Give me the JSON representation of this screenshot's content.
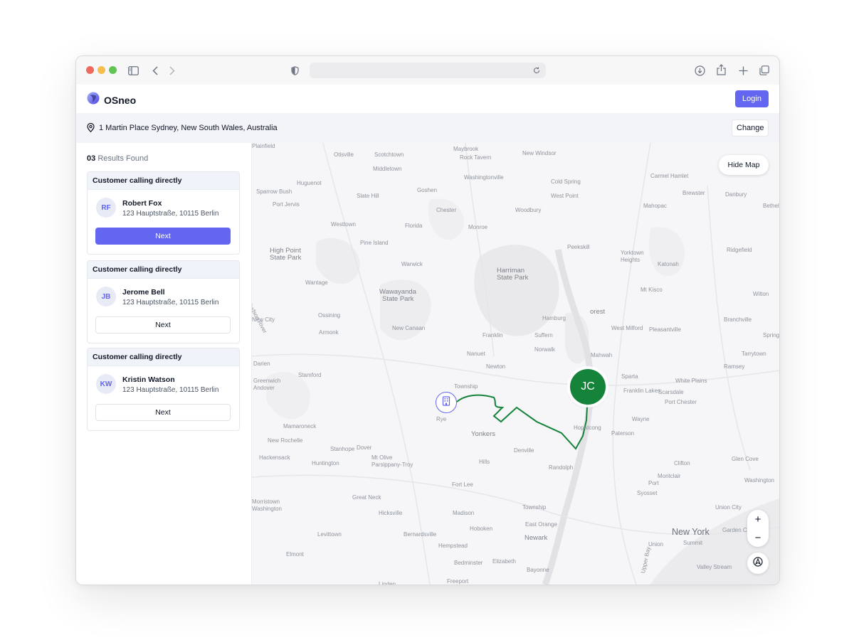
{
  "app": {
    "brand_name": "OSneo",
    "login_label": "Login"
  },
  "location": {
    "address": "1 Martin Place Sydney, New South Wales, Australia",
    "change_label": "Change"
  },
  "results": {
    "count": "03",
    "label": "Results Found"
  },
  "cards": [
    {
      "header": "Customer calling directly",
      "initials": "RF",
      "name": "Robert Fox",
      "address": "123 Hauptstraße, 10115 Berlin",
      "button": "Next",
      "primary": true
    },
    {
      "header": "Customer calling directly",
      "initials": "JB",
      "name": "Jerome Bell",
      "address": "123 Hauptstraße, 10115 Berlin",
      "button": "Next",
      "primary": false
    },
    {
      "header": "Customer calling directly",
      "initials": "KW",
      "name": "Kristin Watson",
      "address": "123 Hauptstraße, 10115 Berlin",
      "button": "Next",
      "primary": false
    }
  ],
  "map": {
    "hide_label": "Hide Map",
    "zoom_in": "+",
    "zoom_out": "−",
    "driver_initials": "JC",
    "route_color": "#16833a",
    "accent_color": "#6366f1",
    "places": [
      {
        "t": "Otisville",
        "c": "s"
      },
      {
        "t": "Scotchtown",
        "c": "s"
      },
      {
        "t": "Maybrook",
        "c": "s"
      },
      {
        "t": "Rock Tavern",
        "c": "s"
      },
      {
        "t": "New Windsor",
        "c": "s"
      },
      {
        "t": "Middletown",
        "c": "s"
      },
      {
        "t": "Washingtonville",
        "c": "s"
      },
      {
        "t": "Cold Spring",
        "c": "s"
      },
      {
        "t": "Carmel Hamlet",
        "c": "s"
      },
      {
        "t": "Huguenot",
        "c": "s"
      },
      {
        "t": "Sparrow Bush",
        "c": "s"
      },
      {
        "t": "Slate Hill",
        "c": "s"
      },
      {
        "t": "Goshen",
        "c": "s"
      },
      {
        "t": "West Point",
        "c": "s"
      },
      {
        "t": "Brewster",
        "c": "s"
      },
      {
        "t": "Danbury",
        "c": "s"
      },
      {
        "t": "Port Jervis",
        "c": "s"
      },
      {
        "t": "Chester",
        "c": "s"
      },
      {
        "t": "Woodbury",
        "c": "s"
      },
      {
        "t": "Mahopac",
        "c": "s"
      },
      {
        "t": "Bethel",
        "c": "s"
      },
      {
        "t": "Westtown",
        "c": "s"
      },
      {
        "t": "Florida",
        "c": "s"
      },
      {
        "t": "Monroe",
        "c": "s"
      },
      {
        "t": "Pine Island",
        "c": "s"
      },
      {
        "t": "Peekskill",
        "c": "s"
      },
      {
        "t": "Ridgefield",
        "c": "s"
      },
      {
        "t": "High Point",
        "c": "m"
      },
      {
        "t": "State Park",
        "c": "m"
      },
      {
        "t": "Yorktown",
        "c": "s"
      },
      {
        "t": "Heights",
        "c": "s"
      },
      {
        "t": "Harriman",
        "c": "m"
      },
      {
        "t": "State Park",
        "c": "m"
      },
      {
        "t": "Warwick",
        "c": "s"
      },
      {
        "t": "Katonah",
        "c": "s"
      },
      {
        "t": "Wantage",
        "c": "s"
      },
      {
        "t": "Wawayanda",
        "c": "m"
      },
      {
        "t": "State Park",
        "c": "m"
      },
      {
        "t": "Mt Kisco",
        "c": "s"
      },
      {
        "t": "Wilton",
        "c": "s"
      },
      {
        "t": "Hudson River",
        "c": "s"
      },
      {
        "t": "orest",
        "c": "m"
      },
      {
        "t": "Ossining",
        "c": "s"
      },
      {
        "t": "Hamburg",
        "c": "s"
      },
      {
        "t": "New City",
        "c": "s"
      },
      {
        "t": "Branchville",
        "c": "s"
      },
      {
        "t": "New Canaan",
        "c": "s"
      },
      {
        "t": "West Milford",
        "c": "s"
      },
      {
        "t": "Pleasantville",
        "c": "s"
      },
      {
        "t": "Armonk",
        "c": "s"
      },
      {
        "t": "Franklin",
        "c": "s"
      },
      {
        "t": "Suffern",
        "c": "s"
      },
      {
        "t": "Spring Valley",
        "c": "s"
      },
      {
        "t": "Norwalk",
        "c": "s"
      },
      {
        "t": "Nanuet",
        "c": "s"
      },
      {
        "t": "Mahwah",
        "c": "s"
      },
      {
        "t": "Tarrytown",
        "c": "s"
      },
      {
        "t": "Darien",
        "c": "s"
      },
      {
        "t": "Newton",
        "c": "s"
      },
      {
        "t": "Ramsey",
        "c": "s"
      },
      {
        "t": "Stamford",
        "c": "s"
      },
      {
        "t": "Sparta",
        "c": "s"
      },
      {
        "t": "White Plains",
        "c": "s"
      },
      {
        "t": "Greenwich",
        "c": "s"
      },
      {
        "t": "Andover",
        "c": "s"
      },
      {
        "t": "Township",
        "c": "s"
      },
      {
        "t": "Franklin Lakes",
        "c": "s"
      },
      {
        "t": "Scarsdale",
        "c": "s"
      },
      {
        "t": "Port Chester",
        "c": "s"
      },
      {
        "t": "Rye",
        "c": "s"
      },
      {
        "t": "Wayne",
        "c": "s"
      },
      {
        "t": "Mamaroneck",
        "c": "s"
      },
      {
        "t": "Hopatcong",
        "c": "s"
      },
      {
        "t": "Yonkers",
        "c": "m"
      },
      {
        "t": "Paterson",
        "c": "s"
      },
      {
        "t": "New Rochelle",
        "c": "s"
      },
      {
        "t": "Stanhope",
        "c": "s"
      },
      {
        "t": "Dover",
        "c": "s"
      },
      {
        "t": "Denville",
        "c": "s"
      },
      {
        "t": "Hackensack",
        "c": "s"
      },
      {
        "t": "Mt Olive",
        "c": "s"
      },
      {
        "t": "Parsippany-Troy",
        "c": "s"
      },
      {
        "t": "Hills",
        "c": "s"
      },
      {
        "t": "Clifton",
        "c": "s"
      },
      {
        "t": "Glen Cove",
        "c": "s"
      },
      {
        "t": "Huntington",
        "c": "s"
      },
      {
        "t": "Randolph",
        "c": "s"
      },
      {
        "t": "Fort Lee",
        "c": "s"
      },
      {
        "t": "Montclair",
        "c": "s"
      },
      {
        "t": "Port",
        "c": "s"
      },
      {
        "t": "Washington",
        "c": "s"
      },
      {
        "t": "Syosset",
        "c": "s"
      },
      {
        "t": "Great Neck",
        "c": "s"
      },
      {
        "t": "Morristown",
        "c": "s"
      },
      {
        "t": "Washington",
        "c": "s"
      },
      {
        "t": "Township",
        "c": "s"
      },
      {
        "t": "Union City",
        "c": "s"
      },
      {
        "t": "Hicksville",
        "c": "s"
      },
      {
        "t": "Madison",
        "c": "s"
      },
      {
        "t": "East Orange",
        "c": "s"
      },
      {
        "t": "Hoboken",
        "c": "s"
      },
      {
        "t": "Newark",
        "c": "m"
      },
      {
        "t": "New York",
        "c": "b"
      },
      {
        "t": "Garden City",
        "c": "s"
      },
      {
        "t": "Levittown",
        "c": "s"
      },
      {
        "t": "Bernardsville",
        "c": "s"
      },
      {
        "t": "Summit",
        "c": "s"
      },
      {
        "t": "Hempstead",
        "c": "s"
      },
      {
        "t": "Union",
        "c": "s"
      },
      {
        "t": "Elmont",
        "c": "s"
      },
      {
        "t": "Bedminster",
        "c": "s"
      },
      {
        "t": "Elizabeth",
        "c": "s"
      },
      {
        "t": "Bayonne",
        "c": "s"
      },
      {
        "t": "Upper Bay",
        "c": "s"
      },
      {
        "t": "Valley Stream",
        "c": "s"
      },
      {
        "t": "Freeport",
        "c": "s"
      },
      {
        "t": "Linden",
        "c": "s"
      },
      {
        "t": "Plainfield",
        "c": "s"
      }
    ]
  }
}
